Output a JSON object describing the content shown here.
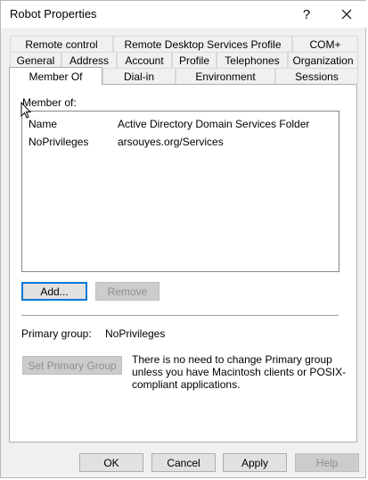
{
  "window": {
    "title": "Robot Properties",
    "help_glyph": "?",
    "close_glyph": "✕"
  },
  "tabs": {
    "row1": [
      "Remote control",
      "Remote Desktop Services Profile",
      "COM+"
    ],
    "row2": [
      "General",
      "Address",
      "Account",
      "Profile",
      "Telephones",
      "Organization"
    ],
    "row3": [
      "Member Of",
      "Dial-in",
      "Environment",
      "Sessions"
    ],
    "selected": "Member Of"
  },
  "member_of": {
    "label": "Member of:",
    "columns": [
      "Name",
      "Active Directory Domain Services Folder"
    ],
    "rows": [
      {
        "name": "NoPrivileges",
        "folder": "arsouyes.org/Services"
      }
    ]
  },
  "buttons": {
    "add": "Add...",
    "remove": "Remove",
    "set_primary": "Set Primary Group"
  },
  "primary_group": {
    "label": "Primary group:",
    "value": "NoPrivileges",
    "explanation": "There is no need to change Primary group unless you have Macintosh clients or POSIX-compliant applications."
  },
  "footer": {
    "ok": "OK",
    "cancel": "Cancel",
    "apply": "Apply",
    "help": "Help"
  }
}
